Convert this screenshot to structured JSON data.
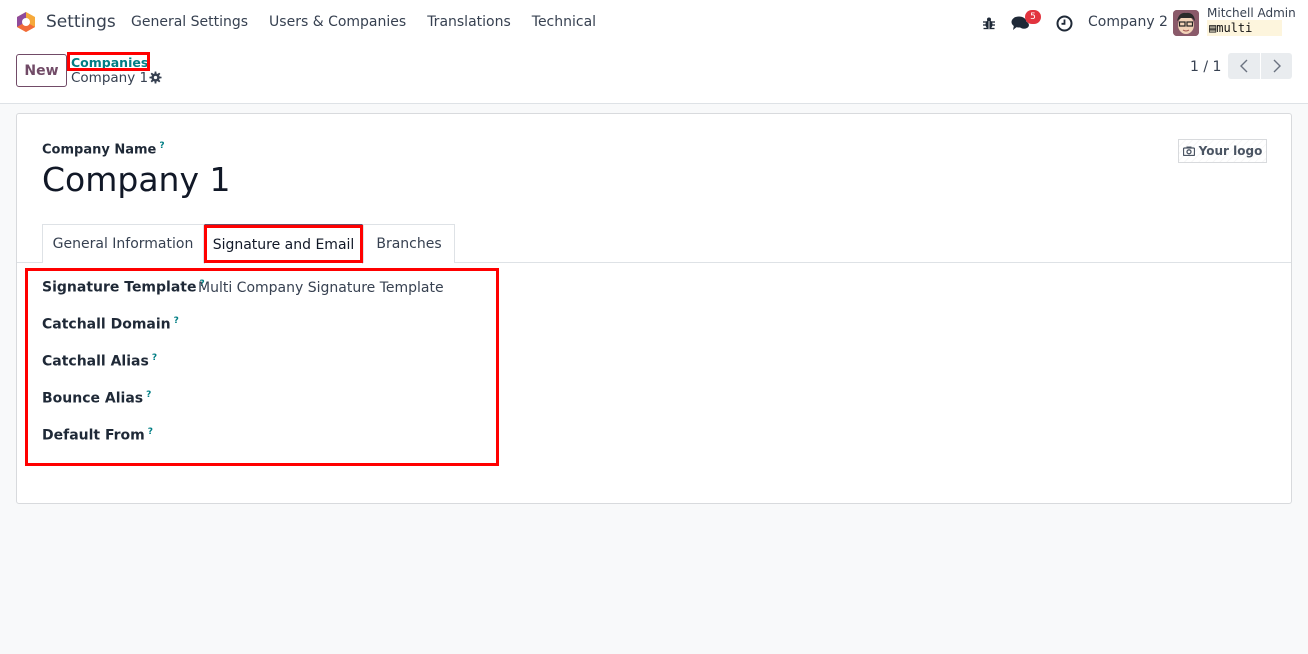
{
  "navbar": {
    "app_name": "Settings",
    "menu": [
      "General Settings",
      "Users & Companies",
      "Translations",
      "Technical"
    ],
    "icons": [
      "debug-icon",
      "chat-icon",
      "clock-icon"
    ],
    "messages_badge": "5",
    "company_switcher": "Company 2",
    "user_name": "Mitchell Admin",
    "database": "multi"
  },
  "control_panel": {
    "new_label": "New",
    "breadcrumb_parent": "Companies",
    "breadcrumb_current": "Company 1",
    "pager": "1 / 1"
  },
  "form": {
    "company_name_label": "Company Name",
    "help_mark": "?",
    "company_name": "Company 1",
    "logo_placeholder": "Your logo",
    "tabs": [
      {
        "label": "General Information",
        "active": false
      },
      {
        "label": "Signature and Email",
        "active": true
      },
      {
        "label": "Branches",
        "active": false
      }
    ],
    "fields": [
      {
        "label": "Signature Template",
        "value": "Multi Company Signature Template"
      },
      {
        "label": "Catchall Domain",
        "value": ""
      },
      {
        "label": "Catchall Alias",
        "value": ""
      },
      {
        "label": "Bounce Alias",
        "value": ""
      },
      {
        "label": "Default From",
        "value": ""
      }
    ]
  },
  "colors": {
    "brand": "#714b67",
    "link": "#017e84",
    "badge": "#e2343f",
    "annotation": "#ff0000"
  }
}
